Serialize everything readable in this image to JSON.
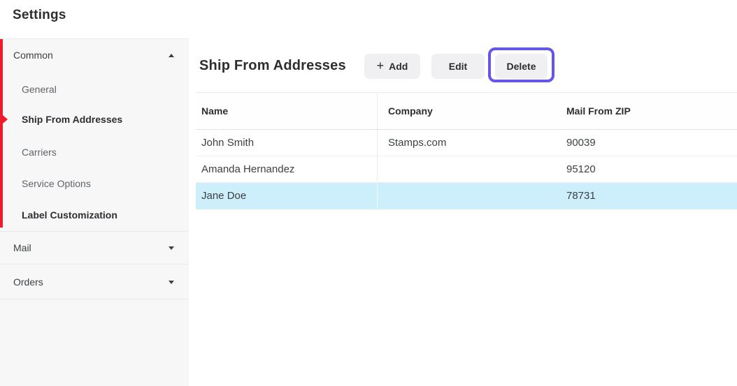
{
  "page": {
    "title": "Settings"
  },
  "colors": {
    "accent_red": "#ee1b2c",
    "highlight_purple": "#6456e8",
    "selected_row_blue": "#cdeefb",
    "sidebar_bg": "#f7f7f8",
    "button_bg": "#f0f0f2"
  },
  "icons": {
    "plus": "+"
  },
  "sidebar": {
    "sections": [
      {
        "label": "Common",
        "expanded": true,
        "children": [
          {
            "label": "General",
            "state": "normal"
          },
          {
            "label": "Ship From Addresses",
            "state": "selected"
          },
          {
            "label": "Carriers",
            "state": "normal"
          },
          {
            "label": "Service Options",
            "state": "normal"
          },
          {
            "label": "Label Customization",
            "state": "emphasized"
          }
        ]
      },
      {
        "label": "Mail",
        "expanded": false,
        "children": []
      },
      {
        "label": "Orders",
        "expanded": false,
        "children": []
      }
    ]
  },
  "main": {
    "title": "Ship From Addresses",
    "toolbar": {
      "add_label": "Add",
      "edit_label": "Edit",
      "delete_label": "Delete",
      "highlighted_button": "Delete"
    },
    "table": {
      "columns": {
        "name": "Name",
        "company": "Company",
        "zip": "Mail From ZIP"
      },
      "rows": [
        {
          "name": "John Smith",
          "company": "Stamps.com",
          "zip": "90039",
          "selected": false
        },
        {
          "name": "Amanda Hernandez",
          "company": "",
          "zip": "95120",
          "selected": false
        },
        {
          "name": "Jane Doe",
          "company": "",
          "zip": "78731",
          "selected": true
        }
      ]
    }
  }
}
